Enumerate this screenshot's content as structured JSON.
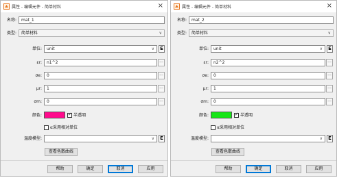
{
  "dialogs": [
    {
      "title": "属性 - 编辑元件 - 简单材料",
      "name_label": "名称:",
      "name_value": "mat_1",
      "type_label": "类型:",
      "type_value": "简单材料",
      "unit_label": "单位:",
      "unit_value": "unit",
      "epsilon_label": "εr:",
      "epsilon_value": "n1^2",
      "sigma_e_label": "σe:",
      "sigma_e_value": "0",
      "mu_label": "μr:",
      "mu_value": "1",
      "sigma_m_label": "σm:",
      "sigma_m_value": "0",
      "color_label": "颜色:",
      "color_hex": "#ff0a8c",
      "semi_transparent_label": "半透明",
      "semi_transparent_checked": true,
      "relative_unit_label": "α采用相对单位",
      "relative_unit_checked": false,
      "temperature_model_label": "温度模型:",
      "temperature_model_value": "",
      "dispersion_button": "查看色散曲线",
      "help_button": "帮助",
      "ok_button": "确定",
      "cancel_button": "取消",
      "apply_button": "应用",
      "e_button": "E",
      "dots_button": "..."
    },
    {
      "title": "属性 - 编辑元件 - 简单材料",
      "name_label": "名称:",
      "name_value": "mat_2",
      "type_label": "类型:",
      "type_value": "简单材料",
      "unit_label": "单位:",
      "unit_value": "unit",
      "epsilon_label": "εr:",
      "epsilon_value": "n2^2",
      "sigma_e_label": "σe:",
      "sigma_e_value": "0",
      "mu_label": "μr:",
      "mu_value": "1",
      "sigma_m_label": "σm:",
      "sigma_m_value": "0",
      "color_label": "颜色:",
      "color_hex": "#17e617",
      "semi_transparent_label": "半透明",
      "semi_transparent_checked": true,
      "relative_unit_label": "α采用相对单位",
      "relative_unit_checked": false,
      "temperature_model_label": "温度模型:",
      "temperature_model_value": "",
      "dispersion_button": "查看色散曲线",
      "help_button": "帮助",
      "ok_button": "确定",
      "cancel_button": "取消",
      "apply_button": "应用",
      "e_button": "E",
      "dots_button": "..."
    }
  ],
  "icons": {
    "app": "dialog-app-icon",
    "close": "close-icon",
    "dropdown": "chevron-down-icon"
  },
  "glyphs": {
    "close": "×",
    "chevron": "∨",
    "check": "✓"
  },
  "colors": {
    "window_background": "#f0f0f0",
    "accent": "#0078d7",
    "icon_orange": "#e87722"
  }
}
